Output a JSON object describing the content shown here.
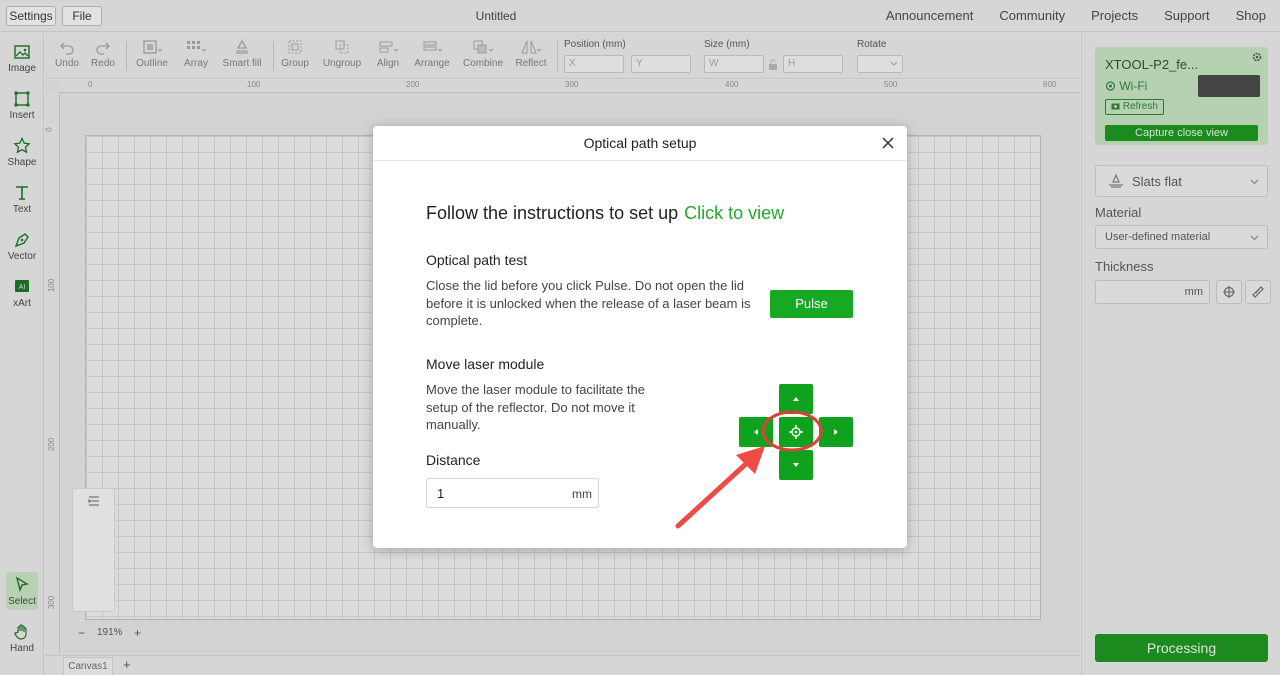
{
  "menubar": {
    "settings_label": "Settings",
    "file_label": "File",
    "doc_title": "Untitled",
    "links": [
      "Announcement",
      "Community",
      "Projects",
      "Support",
      "Shop"
    ]
  },
  "left_tools": [
    {
      "label": "Image",
      "icon": "image-icon"
    },
    {
      "label": "Insert",
      "icon": "insert-icon"
    },
    {
      "label": "Shape",
      "icon": "shape-icon"
    },
    {
      "label": "Text",
      "icon": "text-icon"
    },
    {
      "label": "Vector",
      "icon": "vector-icon"
    },
    {
      "label": "xArt",
      "icon": "xart-icon"
    }
  ],
  "bottom_tools": [
    {
      "label": "Select",
      "icon": "select-icon"
    },
    {
      "label": "Hand",
      "icon": "hand-icon"
    }
  ],
  "top_tools": [
    "Undo",
    "Redo",
    "Outline",
    "Array",
    "Smart fill",
    "Group",
    "Ungroup",
    "Align",
    "Arrange",
    "Combine",
    "Reflect"
  ],
  "properties": {
    "position_label": "Position (mm)",
    "x_placeholder": "X",
    "y_placeholder": "Y",
    "size_label": "Size (mm)",
    "w_placeholder": "W",
    "h_placeholder": "H",
    "rotate_label": "Rotate"
  },
  "ruler": {
    "top": [
      "0",
      "100",
      "200",
      "300",
      "400",
      "500",
      "600"
    ],
    "left": [
      "0",
      "100",
      "200",
      "300"
    ]
  },
  "zoom": {
    "minus": "−",
    "value": "191%",
    "plus": "+"
  },
  "canvas_tabs": {
    "tab": "Canvas1",
    "add": "+"
  },
  "right_panel": {
    "device_name": "XTOOL-P2_fe...",
    "connection": "Wi-Fi",
    "refresh_label": "Refresh",
    "capture_label": "Capture close view",
    "bed_label": "Slats flat",
    "material_label": "Material",
    "material_value": "User-defined material",
    "thickness_label": "Thickness",
    "thickness_unit": "mm",
    "processing_label": "Processing"
  },
  "modal": {
    "title": "Optical path setup",
    "follow_text": "Follow the instructions to set up",
    "follow_link": "Click to view",
    "test_heading": "Optical path test",
    "test_desc": "Close the lid before you click Pulse. Do not open the lid before it is unlocked when the release of a laser beam is complete.",
    "pulse_label": "Pulse",
    "move_heading": "Move laser module",
    "move_desc": "Move the laser module to facilitate the setup of the reflector. Do not move it manually.",
    "distance_label": "Distance",
    "distance_value": "1",
    "distance_unit": "mm"
  },
  "colors": {
    "accent": "#16aa24",
    "link": "#22a82d",
    "highlight_circle": "#e0403a",
    "arrow": "#ee4b45"
  }
}
